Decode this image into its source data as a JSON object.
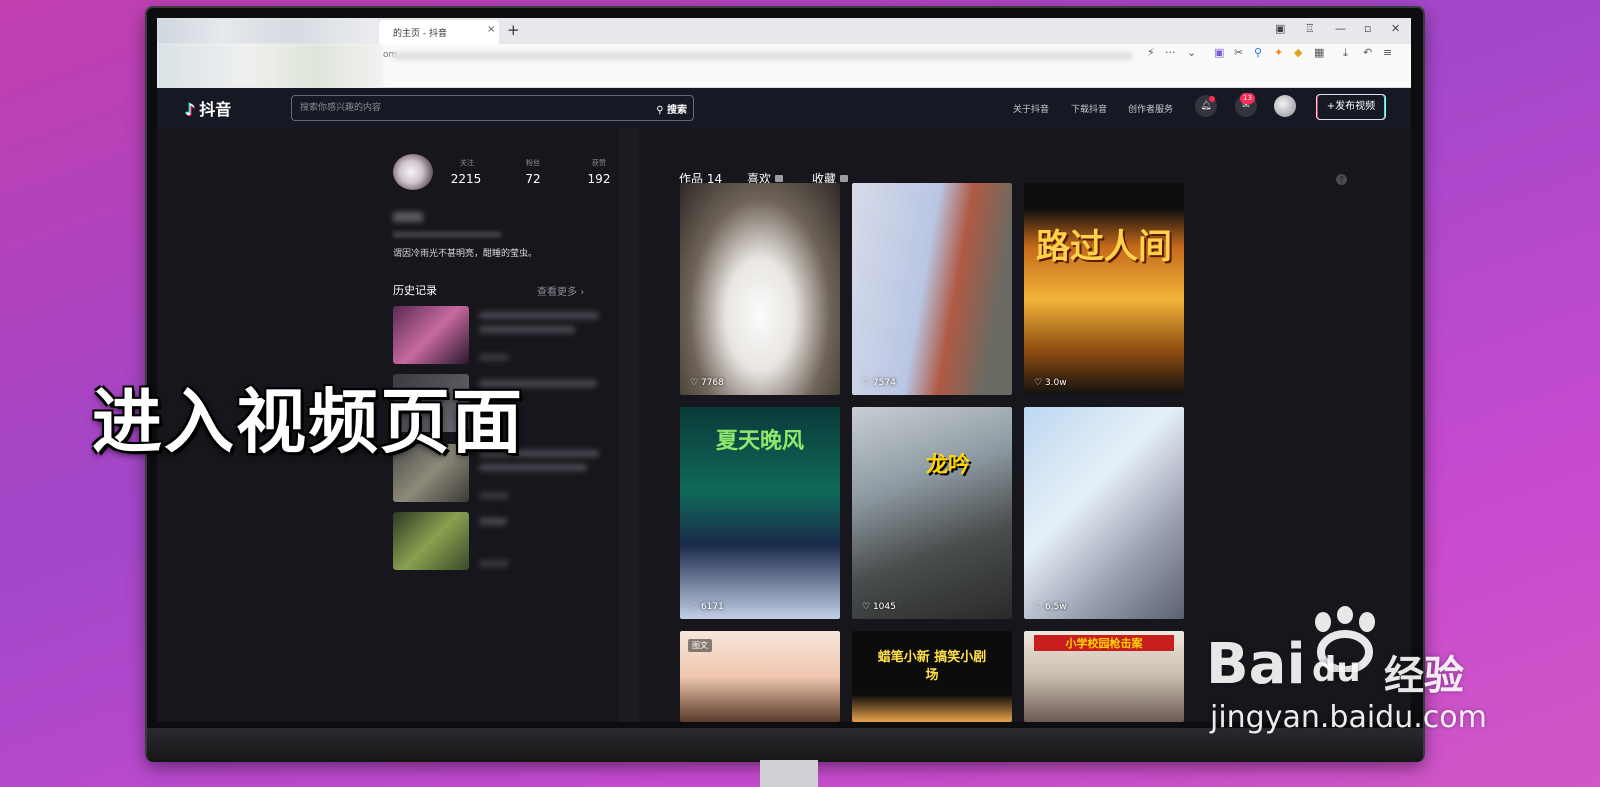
{
  "overlay_caption": "进入视频页面",
  "browser": {
    "tab_title": "的主页 - 抖音",
    "tab_close": "×",
    "new_tab": "+",
    "url_fragment": "om",
    "window_controls": [
      "—",
      "▫",
      "✕"
    ]
  },
  "site": {
    "logo_text": "抖音",
    "search_placeholder": "搜索你感兴趣的内容",
    "search_button": "搜索",
    "nav": [
      "关于抖音",
      "下载抖音",
      "创作者服务"
    ],
    "message_badge": "13",
    "publish_button": "+发布视频"
  },
  "profile": {
    "stats": [
      {
        "label": "关注",
        "value": "2215"
      },
      {
        "label": "粉丝",
        "value": "72"
      },
      {
        "label": "获赞",
        "value": "192"
      }
    ],
    "bio": "谓因冷雨光不甚明亮，酣睡的莹虫。",
    "history_title": "历史记录",
    "see_more": "查看更多"
  },
  "content_tabs": [
    {
      "label": "作品 14",
      "locked": false
    },
    {
      "label": "喜欢",
      "locked": true
    },
    {
      "label": "收藏",
      "locked": true
    }
  ],
  "videos": [
    {
      "likes": "7768",
      "art": ""
    },
    {
      "likes": "7574",
      "art": ""
    },
    {
      "likes": "3.0w",
      "art": "路过人间"
    },
    {
      "likes": "6171",
      "art": "夏天晚风"
    },
    {
      "likes": "1045",
      "art": "龙吟"
    },
    {
      "likes": "6.5w",
      "art": ""
    },
    {
      "likes": "",
      "art": "",
      "badge": "图文"
    },
    {
      "likes": "",
      "art": "蜡笔小新 搞笑小剧场"
    },
    {
      "likes": "",
      "art": "小学校园枪击案"
    }
  ],
  "watermark": {
    "brand": "Bai",
    "brand_suffix": "du",
    "product": "经验",
    "url": "jingyan.baidu.com"
  },
  "colors": {
    "accent_red": "#fe2c55",
    "accent_cyan": "#25f4ee",
    "page_bg": "#16161c"
  }
}
